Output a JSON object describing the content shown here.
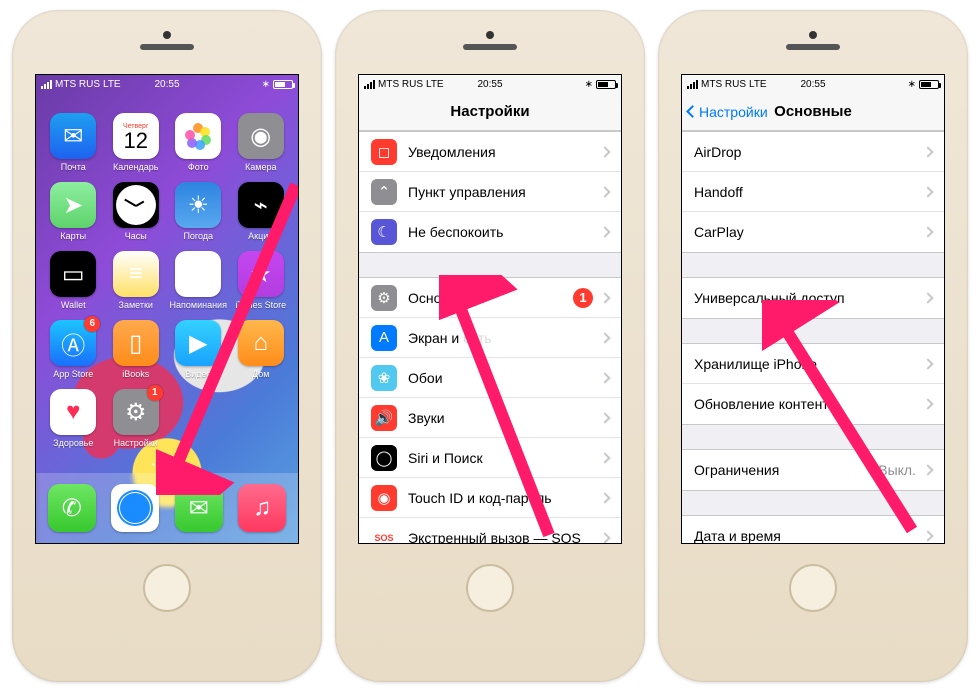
{
  "status": {
    "carrier": "MTS RUS",
    "network": "LTE",
    "time": "20:55"
  },
  "home": {
    "calendar": {
      "weekday": "Четверг",
      "day": "12"
    },
    "apps": [
      {
        "name": "mail",
        "label": "Почта",
        "color": "linear-gradient(#1e9ff0,#1e62f0)",
        "glyph": "✉"
      },
      {
        "name": "calendar",
        "label": "Календарь",
        "color": "#fff",
        "glyph": ""
      },
      {
        "name": "photos",
        "label": "Фото",
        "color": "#fff",
        "glyph": "✿"
      },
      {
        "name": "camera",
        "label": "Камера",
        "color": "#8e8e93",
        "glyph": "◉"
      },
      {
        "name": "maps",
        "label": "Карты",
        "color": "linear-gradient(#8deea0,#5ed36b)",
        "glyph": "➤"
      },
      {
        "name": "clock",
        "label": "Часы",
        "color": "#000",
        "glyph": ""
      },
      {
        "name": "weather",
        "label": "Погода",
        "color": "linear-gradient(#2d84e0,#59a8f0)",
        "glyph": "☀"
      },
      {
        "name": "stocks",
        "label": "Акции",
        "color": "#000",
        "glyph": "⌁"
      },
      {
        "name": "wallet",
        "label": "Wallet",
        "color": "#000",
        "glyph": "▭"
      },
      {
        "name": "notes",
        "label": "Заметки",
        "color": "linear-gradient(#fff,#ffe066)",
        "glyph": "≡"
      },
      {
        "name": "reminders",
        "label": "Напоминания",
        "color": "#fff",
        "glyph": "≣"
      },
      {
        "name": "itunes",
        "label": "iTunes Store",
        "color": "linear-gradient(#c446f0,#b33de0)",
        "glyph": "★"
      },
      {
        "name": "appstore",
        "label": "App Store",
        "color": "linear-gradient(#1cc4fd,#1a6ffd)",
        "glyph": "Ⓐ",
        "badge": "6"
      },
      {
        "name": "ibooks",
        "label": "iBooks",
        "color": "linear-gradient(#ffa94d,#ff8c1a)",
        "glyph": "▯"
      },
      {
        "name": "video",
        "label": "Видео",
        "color": "linear-gradient(#33d1ff,#1aa3ff)",
        "glyph": "▶"
      },
      {
        "name": "home-app",
        "label": "Дом",
        "color": "linear-gradient(#ffb84d,#ff8c1a)",
        "glyph": "⌂"
      },
      {
        "name": "health",
        "label": "Здоровье",
        "color": "#fff",
        "glyph": "♥"
      },
      {
        "name": "settings",
        "label": "Настройки",
        "color": "#8e8e93",
        "glyph": "⚙",
        "badge": "1"
      }
    ],
    "dock": [
      {
        "name": "phone",
        "color": "linear-gradient(#6ee663,#37c82e)",
        "glyph": "✆"
      },
      {
        "name": "safari",
        "color": "#fff",
        "glyph": "◎"
      },
      {
        "name": "messages",
        "color": "linear-gradient(#6ee663,#37c82e)",
        "glyph": "✉"
      },
      {
        "name": "music",
        "color": "linear-gradient(#ff6b8d,#ff3860)",
        "glyph": "♫"
      }
    ]
  },
  "settings": {
    "title": "Настройки",
    "group1": [
      {
        "name": "notifications",
        "label": "Уведомления",
        "color": "#ff3b30",
        "glyph": "◻"
      },
      {
        "name": "control-center",
        "label": "Пункт управления",
        "color": "#8e8e93",
        "glyph": "⌃"
      },
      {
        "name": "dnd",
        "label": "Не беспокоить",
        "color": "#5856d6",
        "glyph": "☾"
      }
    ],
    "group2": [
      {
        "name": "general",
        "label": "Основные",
        "color": "#8e8e93",
        "glyph": "⚙",
        "badge": "1"
      },
      {
        "name": "display",
        "label": "Экран и яркость",
        "color": "#007aff",
        "glyph": "A",
        "label_cut": "Экран и"
      },
      {
        "name": "wallpaper",
        "label": "Обои",
        "color": "#50c8f0",
        "glyph": "❀"
      },
      {
        "name": "sounds",
        "label": "Звуки",
        "color": "#ff3b30",
        "glyph": "🔊"
      },
      {
        "name": "siri",
        "label": "Siri и Поиск",
        "color": "#000",
        "glyph": "◯"
      },
      {
        "name": "touchid",
        "label": "Touch ID и код-пароль",
        "color": "#ff3b30",
        "glyph": "◉"
      },
      {
        "name": "sos",
        "label": "Экстренный вызов — SOS",
        "color": "#fff",
        "glyph": "SOS",
        "text_color": "#ff3b30"
      }
    ]
  },
  "general": {
    "back": "Настройки",
    "title": "Основные",
    "group1": [
      {
        "name": "airdrop",
        "label": "AirDrop"
      },
      {
        "name": "handoff",
        "label": "Handoff"
      },
      {
        "name": "carplay",
        "label": "CarPlay"
      }
    ],
    "group2": [
      {
        "name": "accessibility",
        "label": "Универсальный доступ"
      }
    ],
    "group3": [
      {
        "name": "storage",
        "label": "Хранилище iPhone"
      },
      {
        "name": "background-refresh",
        "label": "Обновление контента"
      }
    ],
    "group4": [
      {
        "name": "restrictions",
        "label": "Ограничения",
        "detail": "Выкл."
      }
    ],
    "group5": [
      {
        "name": "date-time",
        "label": "Дата и время"
      }
    ]
  }
}
